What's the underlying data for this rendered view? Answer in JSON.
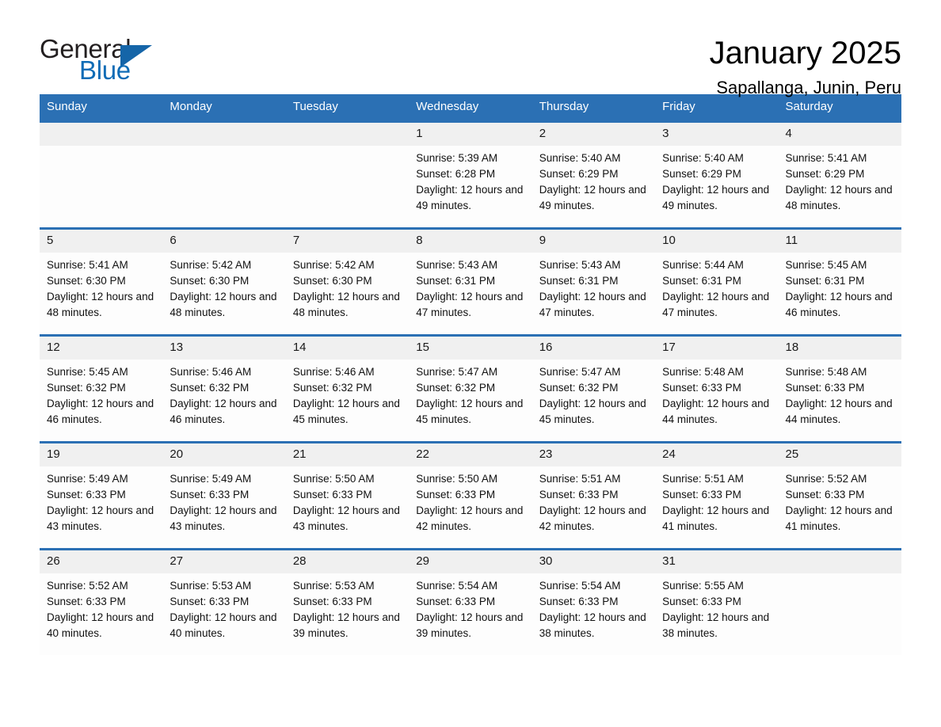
{
  "logo": {
    "word_one": "General",
    "word_two": "Blue",
    "triangle_color": "#1565a8",
    "blue_text_color": "#0f6cb6"
  },
  "header": {
    "title": "January 2025",
    "subtitle": "Sapallanga, Junin, Peru"
  },
  "theme": {
    "header_blue": "#2b70b4",
    "daynum_bg": "#f0f0f0",
    "cell_bg": "#fdfdfd",
    "row_divider": "#2b70b4"
  },
  "weekday_headers": [
    "Sunday",
    "Monday",
    "Tuesday",
    "Wednesday",
    "Thursday",
    "Friday",
    "Saturday"
  ],
  "weeks": [
    [
      {
        "day": "",
        "empty": true
      },
      {
        "day": "",
        "empty": true
      },
      {
        "day": "",
        "empty": true
      },
      {
        "day": "1",
        "sunrise": "Sunrise: 5:39 AM",
        "sunset": "Sunset: 6:28 PM",
        "daylight": "Daylight: 12 hours and 49 minutes."
      },
      {
        "day": "2",
        "sunrise": "Sunrise: 5:40 AM",
        "sunset": "Sunset: 6:29 PM",
        "daylight": "Daylight: 12 hours and 49 minutes."
      },
      {
        "day": "3",
        "sunrise": "Sunrise: 5:40 AM",
        "sunset": "Sunset: 6:29 PM",
        "daylight": "Daylight: 12 hours and 49 minutes."
      },
      {
        "day": "4",
        "sunrise": "Sunrise: 5:41 AM",
        "sunset": "Sunset: 6:29 PM",
        "daylight": "Daylight: 12 hours and 48 minutes."
      }
    ],
    [
      {
        "day": "5",
        "sunrise": "Sunrise: 5:41 AM",
        "sunset": "Sunset: 6:30 PM",
        "daylight": "Daylight: 12 hours and 48 minutes."
      },
      {
        "day": "6",
        "sunrise": "Sunrise: 5:42 AM",
        "sunset": "Sunset: 6:30 PM",
        "daylight": "Daylight: 12 hours and 48 minutes."
      },
      {
        "day": "7",
        "sunrise": "Sunrise: 5:42 AM",
        "sunset": "Sunset: 6:30 PM",
        "daylight": "Daylight: 12 hours and 48 minutes."
      },
      {
        "day": "8",
        "sunrise": "Sunrise: 5:43 AM",
        "sunset": "Sunset: 6:31 PM",
        "daylight": "Daylight: 12 hours and 47 minutes."
      },
      {
        "day": "9",
        "sunrise": "Sunrise: 5:43 AM",
        "sunset": "Sunset: 6:31 PM",
        "daylight": "Daylight: 12 hours and 47 minutes."
      },
      {
        "day": "10",
        "sunrise": "Sunrise: 5:44 AM",
        "sunset": "Sunset: 6:31 PM",
        "daylight": "Daylight: 12 hours and 47 minutes."
      },
      {
        "day": "11",
        "sunrise": "Sunrise: 5:45 AM",
        "sunset": "Sunset: 6:31 PM",
        "daylight": "Daylight: 12 hours and 46 minutes."
      }
    ],
    [
      {
        "day": "12",
        "sunrise": "Sunrise: 5:45 AM",
        "sunset": "Sunset: 6:32 PM",
        "daylight": "Daylight: 12 hours and 46 minutes."
      },
      {
        "day": "13",
        "sunrise": "Sunrise: 5:46 AM",
        "sunset": "Sunset: 6:32 PM",
        "daylight": "Daylight: 12 hours and 46 minutes."
      },
      {
        "day": "14",
        "sunrise": "Sunrise: 5:46 AM",
        "sunset": "Sunset: 6:32 PM",
        "daylight": "Daylight: 12 hours and 45 minutes."
      },
      {
        "day": "15",
        "sunrise": "Sunrise: 5:47 AM",
        "sunset": "Sunset: 6:32 PM",
        "daylight": "Daylight: 12 hours and 45 minutes."
      },
      {
        "day": "16",
        "sunrise": "Sunrise: 5:47 AM",
        "sunset": "Sunset: 6:32 PM",
        "daylight": "Daylight: 12 hours and 45 minutes."
      },
      {
        "day": "17",
        "sunrise": "Sunrise: 5:48 AM",
        "sunset": "Sunset: 6:33 PM",
        "daylight": "Daylight: 12 hours and 44 minutes."
      },
      {
        "day": "18",
        "sunrise": "Sunrise: 5:48 AM",
        "sunset": "Sunset: 6:33 PM",
        "daylight": "Daylight: 12 hours and 44 minutes."
      }
    ],
    [
      {
        "day": "19",
        "sunrise": "Sunrise: 5:49 AM",
        "sunset": "Sunset: 6:33 PM",
        "daylight": "Daylight: 12 hours and 43 minutes."
      },
      {
        "day": "20",
        "sunrise": "Sunrise: 5:49 AM",
        "sunset": "Sunset: 6:33 PM",
        "daylight": "Daylight: 12 hours and 43 minutes."
      },
      {
        "day": "21",
        "sunrise": "Sunrise: 5:50 AM",
        "sunset": "Sunset: 6:33 PM",
        "daylight": "Daylight: 12 hours and 43 minutes."
      },
      {
        "day": "22",
        "sunrise": "Sunrise: 5:50 AM",
        "sunset": "Sunset: 6:33 PM",
        "daylight": "Daylight: 12 hours and 42 minutes."
      },
      {
        "day": "23",
        "sunrise": "Sunrise: 5:51 AM",
        "sunset": "Sunset: 6:33 PM",
        "daylight": "Daylight: 12 hours and 42 minutes."
      },
      {
        "day": "24",
        "sunrise": "Sunrise: 5:51 AM",
        "sunset": "Sunset: 6:33 PM",
        "daylight": "Daylight: 12 hours and 41 minutes."
      },
      {
        "day": "25",
        "sunrise": "Sunrise: 5:52 AM",
        "sunset": "Sunset: 6:33 PM",
        "daylight": "Daylight: 12 hours and 41 minutes."
      }
    ],
    [
      {
        "day": "26",
        "sunrise": "Sunrise: 5:52 AM",
        "sunset": "Sunset: 6:33 PM",
        "daylight": "Daylight: 12 hours and 40 minutes."
      },
      {
        "day": "27",
        "sunrise": "Sunrise: 5:53 AM",
        "sunset": "Sunset: 6:33 PM",
        "daylight": "Daylight: 12 hours and 40 minutes."
      },
      {
        "day": "28",
        "sunrise": "Sunrise: 5:53 AM",
        "sunset": "Sunset: 6:33 PM",
        "daylight": "Daylight: 12 hours and 39 minutes."
      },
      {
        "day": "29",
        "sunrise": "Sunrise: 5:54 AM",
        "sunset": "Sunset: 6:33 PM",
        "daylight": "Daylight: 12 hours and 39 minutes."
      },
      {
        "day": "30",
        "sunrise": "Sunrise: 5:54 AM",
        "sunset": "Sunset: 6:33 PM",
        "daylight": "Daylight: 12 hours and 38 minutes."
      },
      {
        "day": "31",
        "sunrise": "Sunrise: 5:55 AM",
        "sunset": "Sunset: 6:33 PM",
        "daylight": "Daylight: 12 hours and 38 minutes."
      },
      {
        "day": "",
        "empty": true
      }
    ]
  ]
}
